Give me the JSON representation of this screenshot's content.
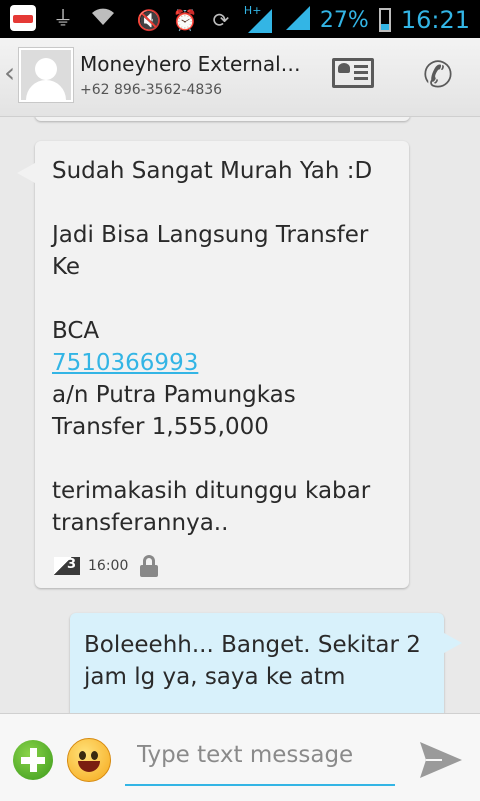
{
  "status_bar": {
    "battery_percent": "27%",
    "time": "16:21",
    "network_type": "H+",
    "icons": [
      "app-notification-icon",
      "usb-icon",
      "wifi-icon",
      "mute-icon",
      "alarm-icon",
      "rotate-icon",
      "signal-icon",
      "battery-icon"
    ]
  },
  "header": {
    "contact_name": "Moneyhero External…",
    "contact_number": "+62 896-3562-4836"
  },
  "messages": [
    {
      "direction": "incoming",
      "line1": "Sudah Sangat Murah Yah :D",
      "line2": "Jadi Bisa Langsung Transfer Ke",
      "bank": "BCA",
      "account_number": "7510366993",
      "account_name": "a/n Putra Pamungkas",
      "amount": "Transfer 1,555,000",
      "closing": "terimakasih ditunggu kabar transferannya..",
      "sim_slot": "3",
      "time": "16:00",
      "locked": true
    },
    {
      "direction": "outgoing",
      "text": "Boleeehh... Banget. Sekitar 2 jam lg ya, saya ke atm"
    }
  ],
  "compose": {
    "placeholder": "Type text message"
  },
  "colors": {
    "accent": "#33b5e5",
    "incoming_bubble": "#f2f2f2",
    "outgoing_bubble": "#d8f1fb",
    "background": "#e9e9e9"
  }
}
